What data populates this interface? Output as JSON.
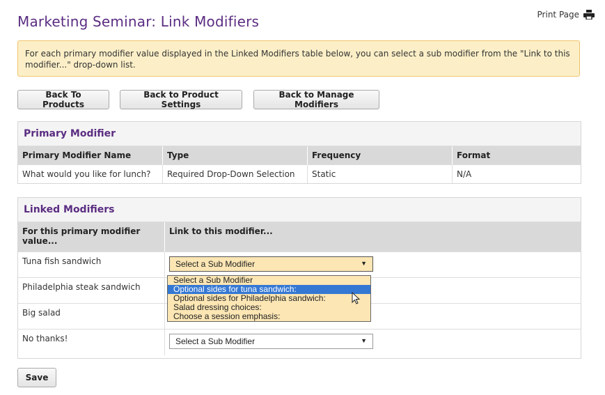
{
  "header": {
    "title": "Marketing Seminar: Link Modifiers",
    "print_label": "Print Page",
    "print_icon": "printer-icon"
  },
  "notice": {
    "text": "For each primary modifier value displayed in the Linked Modifiers table below, you can select a sub modifier from the \"Link to this modifier...\" drop-down list."
  },
  "buttons": {
    "back_products": "Back To Products",
    "back_settings": "Back to Product Settings",
    "back_manage": "Back to Manage Modifiers",
    "save": "Save"
  },
  "primary": {
    "heading": "Primary Modifier",
    "columns": [
      "Primary Modifier Name",
      "Type",
      "Frequency",
      "Format"
    ],
    "row": [
      "What would you like for lunch?",
      "Required Drop-Down Selection",
      "Static",
      "N/A"
    ]
  },
  "linked": {
    "heading": "Linked Modifiers",
    "columns": [
      "For this primary modifier value...",
      "Link to this modifier..."
    ],
    "rows": [
      {
        "value": "Tuna fish sandwich",
        "selected": "Select a Sub Modifier"
      },
      {
        "value": "Philadelphia steak sandwich",
        "selected": ""
      },
      {
        "value": "Big salad",
        "selected": ""
      },
      {
        "value": "No thanks!",
        "selected": "Select a Sub Modifier"
      }
    ],
    "dropdown_options": [
      "Select a Sub Modifier",
      "Optional sides for tuna sandwich:",
      "Optional sides for Philadelphia sandwich:",
      "Salad dressing choices:",
      "Choose a session emphasis:"
    ],
    "highlighted_option": "Optional sides for tuna sandwich:"
  },
  "colors": {
    "title": "#5b2d82",
    "notice_bg": "#fcefc7",
    "dropdown_bg": "#fbe6b4",
    "highlight": "#3478d4"
  }
}
